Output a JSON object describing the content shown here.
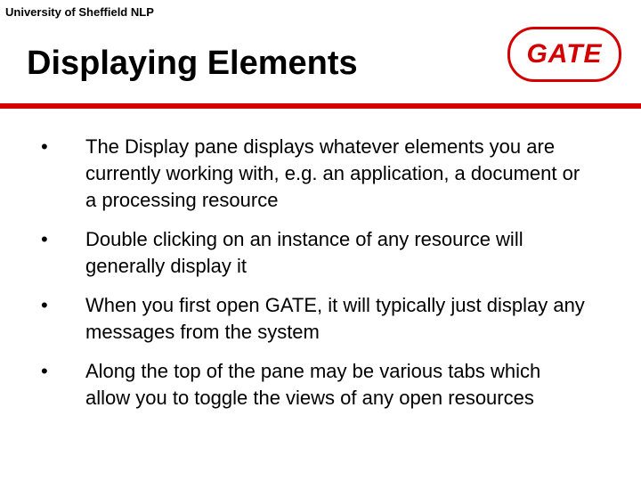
{
  "header": {
    "org": "University of Sheffield NLP"
  },
  "logo": {
    "text": "GATE"
  },
  "title": "Displaying Elements",
  "bullets": [
    "The Display pane displays whatever elements you are currently working with, e.g. an application, a document or a processing resource",
    "Double clicking on an instance of any resource will generally display it",
    "When you first open GATE, it will typically just display any messages from the system",
    "Along the top of the pane may be various tabs which allow you to toggle the views of any open resources"
  ]
}
